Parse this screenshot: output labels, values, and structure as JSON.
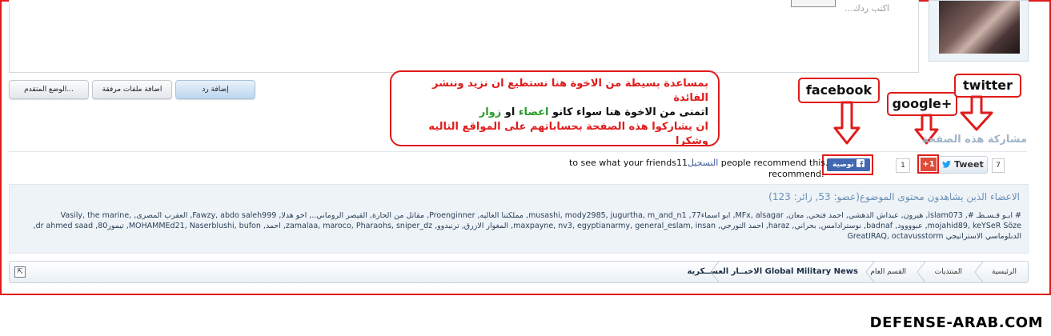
{
  "editor": {
    "placeholder": "اكتب ردك..."
  },
  "buttons": {
    "reply": "إضافة رد",
    "attach": "اضافة ملفات مرفقة",
    "advanced": "الوضع المتقدم..."
  },
  "callout": {
    "line1": "بمساعدة بسيطة من الاخوة هنا نستطيع ان نزيد وننشر الفائدة",
    "line2_a": "اتمنى من الاخوة هنا سواء كانو ",
    "line2_b": "اعضاء",
    "line2_c": " او ",
    "line2_d": "زوار",
    "line3": "ان يشاركوا هذه الصفحة بحساباتهم على المواقع التاليه",
    "line4": "وشكرا"
  },
  "annotations": {
    "facebook": "facebook",
    "google": "google+",
    "twitter": "twitter"
  },
  "share": {
    "title": "مشاركة هذه الصفحة",
    "tweet_count": "7",
    "tweet_label": "Tweet",
    "gplus_count": "1",
    "gplus_label": "+1",
    "fb_label": "توصية",
    "fb_text_1": "11 people recommend this.",
    "fb_signup": "التسجيل",
    "fb_text_2": " to see what your friends",
    "fb_text_3": "recommend."
  },
  "viewers": {
    "title": "الاعضاء الذين يشاهدون محتوى الموضوع",
    "stats": "(عضو: 53, زائر: 123)",
    "members": "# ابـو قـسـطـ #, islam073, هيرون, عبداش الدهشي, احمد فتحي, معان, MFx, alsagar, ابو اسماء77, musashi, mody2985, jugurtha, m_and_n1, مملكتنا الغاليه, Proenginner, مقاتل من الحارة, القيصر الروماني.., اخو هدلا, Fawzy, abdo saleh999, العقرب المصرى, Vasily, the marine, mojahid89, keYSeR Söze, عبوووود, badnaf, نوسترادامس, بحراني, haraz, احمد التورجي, maxpayne, nv3, egyptianarmy, general_eslam, insan, المغوار الازرق, ترنيدوو, zamalaa, maroco, Pharaohs, sniper_dz, احمد, MOHAMMEd21, Naserblushi, bufon, تيمور80, dr ahmed saad, الدبلوماسي الاستراتيجي GreatIRAQ, octavusstorm"
  },
  "breadcrumb": [
    "الرئيسية",
    "المنتديات",
    "القسم العام",
    "الاخبــار العســكرية Global Military News"
  ],
  "watermark": "DEFENSE-ARAB.COM",
  "colors": {
    "annotation_red": "#e01b1b",
    "facebook_blue": "#4267b2",
    "gplus_red": "#dd4b39"
  }
}
